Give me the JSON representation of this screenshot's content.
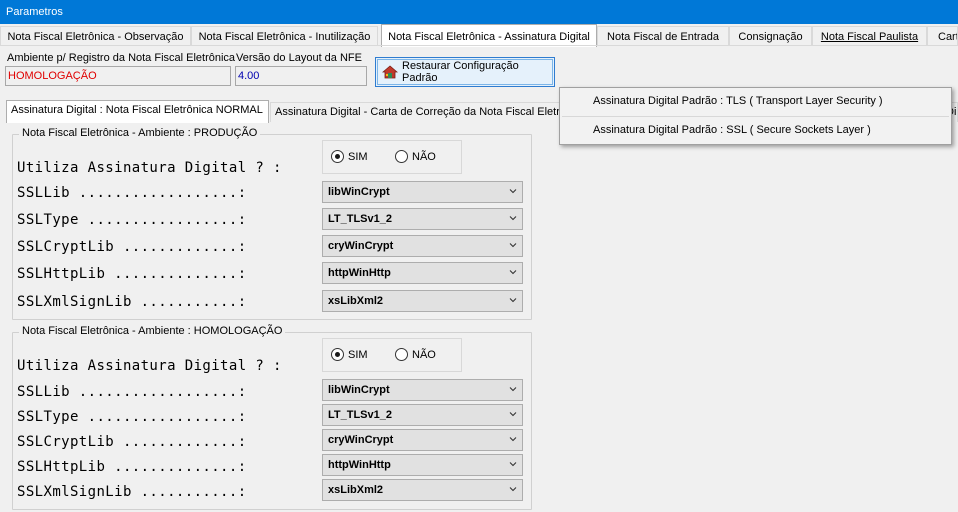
{
  "window": {
    "title": "Parametros"
  },
  "main_tabs": [
    {
      "label": "Nota Fiscal Eletrônica - Observação"
    },
    {
      "label": "Nota Fiscal Eletrônica - Inutilização"
    },
    {
      "label": "Nota Fiscal Eletrônica - Assinatura Digital",
      "active": true
    },
    {
      "label": "Nota Fiscal de Entrada"
    },
    {
      "label": "Consignação"
    },
    {
      "label": "Nota Fiscal Paulista"
    },
    {
      "label": "Cart"
    }
  ],
  "ambiente": {
    "label": "Ambiente p/ Registro da Nota Fiscal Eletrônica",
    "value": "HOMOLOGAÇÃO"
  },
  "versao": {
    "label": "Versão do Layout da NFE",
    "value": "4.00"
  },
  "restore_button": {
    "label": "Restaurar Configuração Padrão",
    "icon": "house-shield-icon"
  },
  "sub_tabs": [
    {
      "label": "Assinatura Digital : Nota Fiscal Eletrônica NORMAL",
      "active": true
    },
    {
      "label": "Assinatura Digital - Carta de Correção da Nota Fiscal Eletrônica"
    },
    {
      "label": "Di"
    }
  ],
  "popup_menu": [
    {
      "label": "Assinatura Digital Padrão : TLS ( Transport Layer Security )"
    },
    {
      "label": "Assinatura Digital Padrão : SSL ( Secure Sockets Layer )"
    }
  ],
  "groups": [
    {
      "title": "Nota Fiscal Eletrônica - Ambiente : PRODUÇÃO",
      "uses_label": "Utiliza Assinatura Digital ? :",
      "radio_sim": "SIM",
      "radio_nao": "NÃO",
      "selected": "SIM",
      "rows": [
        {
          "label": "SSLLib ..................:",
          "value": "libWinCrypt"
        },
        {
          "label": "SSLType .................:",
          "value": "LT_TLSv1_2"
        },
        {
          "label": "SSLCryptLib .............:",
          "value": "cryWinCrypt"
        },
        {
          "label": "SSLHttpLib ..............:",
          "value": "httpWinHttp"
        },
        {
          "label": "SSLXmlSignLib ...........:",
          "value": "xsLibXml2"
        }
      ]
    },
    {
      "title": "Nota Fiscal Eletrônica - Ambiente : HOMOLOGAÇÃO",
      "uses_label": "Utiliza Assinatura Digital ? :",
      "radio_sim": "SIM",
      "radio_nao": "NÃO",
      "selected": "SIM",
      "rows": [
        {
          "label": "SSLLib ..................:",
          "value": "libWinCrypt"
        },
        {
          "label": "SSLType .................:",
          "value": "LT_TLSv1_2"
        },
        {
          "label": "SSLCryptLib .............:",
          "value": "cryWinCrypt"
        },
        {
          "label": "SSLHttpLib ..............:",
          "value": "httpWinHttp"
        },
        {
          "label": "SSLXmlSignLib ...........:",
          "value": "xsLibXml2"
        }
      ]
    }
  ],
  "colors": {
    "titlebar": "#0078d7",
    "ambiente_value": "#e00000",
    "versao_value": "#0000b0"
  }
}
